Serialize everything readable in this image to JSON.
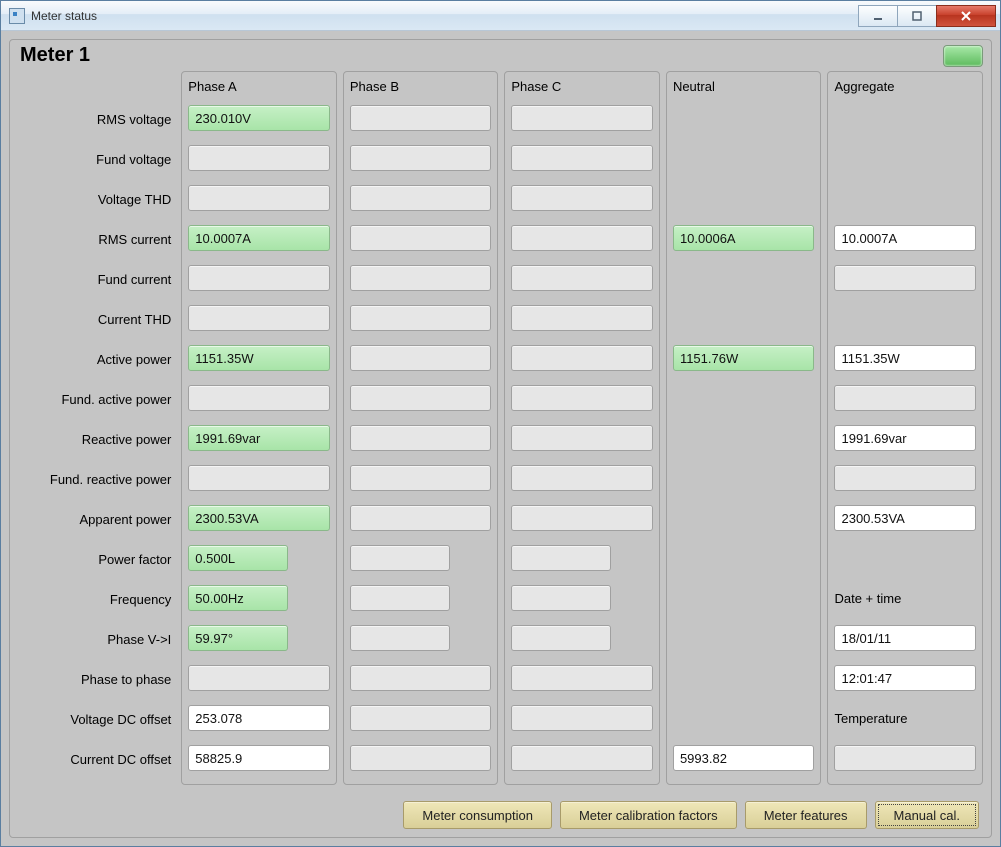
{
  "window": {
    "title": "Meter status"
  },
  "panel": {
    "title": "Meter 1"
  },
  "labels": {
    "rms_voltage": "RMS voltage",
    "fund_voltage": "Fund voltage",
    "voltage_thd": "Voltage THD",
    "rms_current": "RMS current",
    "fund_current": "Fund current",
    "current_thd": "Current THD",
    "active_power": "Active power",
    "fund_active_power": "Fund. active power",
    "reactive_power": "Reactive power",
    "fund_reactive_power": "Fund. reactive power",
    "apparent_power": "Apparent power",
    "power_factor": "Power factor",
    "frequency": "Frequency",
    "phase_vi": "Phase V->I",
    "phase_to_phase": "Phase to phase",
    "voltage_dc_offset": "Voltage DC offset",
    "current_dc_offset": "Current DC offset"
  },
  "column_headers": {
    "phase_a": "Phase A",
    "phase_b": "Phase B",
    "phase_c": "Phase C",
    "neutral": "Neutral",
    "aggregate": "Aggregate"
  },
  "phase_a": {
    "rms_voltage": "230.010V",
    "fund_voltage": "",
    "voltage_thd": "",
    "rms_current": "10.0007A",
    "fund_current": "",
    "current_thd": "",
    "active_power": "1151.35W",
    "fund_active_power": "",
    "reactive_power": "1991.69var",
    "fund_reactive_power": "",
    "apparent_power": "2300.53VA",
    "power_factor": "0.500L",
    "frequency": "50.00Hz",
    "phase_vi": "59.97°",
    "phase_to_phase": "",
    "voltage_dc_offset": "253.078",
    "current_dc_offset": "58825.9"
  },
  "phase_b": {
    "rms_voltage": "",
    "fund_voltage": "",
    "voltage_thd": "",
    "rms_current": "",
    "fund_current": "",
    "current_thd": "",
    "active_power": "",
    "fund_active_power": "",
    "reactive_power": "",
    "fund_reactive_power": "",
    "apparent_power": "",
    "power_factor": "",
    "frequency": "",
    "phase_vi": "",
    "phase_to_phase": "",
    "voltage_dc_offset": "",
    "current_dc_offset": ""
  },
  "phase_c": {
    "rms_voltage": "",
    "fund_voltage": "",
    "voltage_thd": "",
    "rms_current": "",
    "fund_current": "",
    "current_thd": "",
    "active_power": "",
    "fund_active_power": "",
    "reactive_power": "",
    "fund_reactive_power": "",
    "apparent_power": "",
    "power_factor": "",
    "frequency": "",
    "phase_vi": "",
    "phase_to_phase": "",
    "voltage_dc_offset": "",
    "current_dc_offset": ""
  },
  "neutral": {
    "rms_current": "10.0006A",
    "active_power": "1151.76W",
    "current_dc_offset": "5993.82"
  },
  "aggregate": {
    "rms_current": "10.0007A",
    "fund_current": "",
    "active_power": "1151.35W",
    "fund_active_power": "",
    "reactive_power": "1991.69var",
    "fund_reactive_power": "",
    "apparent_power": "2300.53VA",
    "date_time_label": "Date + time",
    "date": "18/01/11",
    "time": "12:01:47",
    "temperature_label": "Temperature",
    "temperature": ""
  },
  "buttons": {
    "meter_consumption": "Meter consumption",
    "meter_calibration_factors": "Meter calibration factors",
    "meter_features": "Meter features",
    "manual_cal": "Manual cal."
  }
}
